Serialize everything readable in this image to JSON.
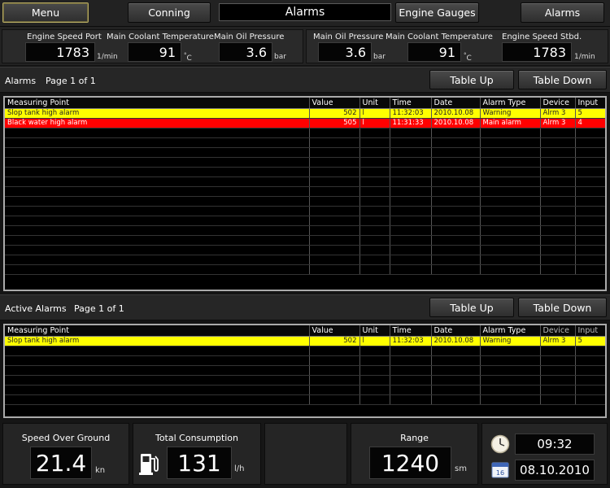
{
  "nav": {
    "menu": "Menu",
    "conning": "Conning",
    "title": "Alarms",
    "engine_gauges": "Engine Gauges",
    "alarms": "Alarms"
  },
  "gauges": {
    "port": [
      {
        "label": "Engine Speed Port",
        "value": "1783",
        "unit": "1/min"
      },
      {
        "label": "Main Coolant Temperature",
        "value": "91",
        "unit_prefix": "°",
        "unit": "C"
      },
      {
        "label": "Main Oil Pressure",
        "value": "3.6",
        "unit": "bar"
      }
    ],
    "stbd": [
      {
        "label": "Main Oil Pressure",
        "value": "3.6",
        "unit": "bar"
      },
      {
        "label": "Main Coolant Temperature",
        "value": "91",
        "unit_prefix": "°",
        "unit": "C"
      },
      {
        "label": "Engine Speed Stbd.",
        "value": "1783",
        "unit": "1/min"
      }
    ]
  },
  "alarms_section": {
    "title": "Alarms",
    "page": "Page 1 of 1",
    "table_up": "Table Up",
    "table_down": "Table Down"
  },
  "active_section": {
    "title": "Active Alarms",
    "page": "Page 1 of 1",
    "table_up": "Table Up",
    "table_down": "Table Down"
  },
  "columns": [
    "Measuring Point",
    "Value",
    "Unit",
    "Time",
    "Date",
    "Alarm Type",
    "Device",
    "Input"
  ],
  "alarm_rows": [
    {
      "point": "Slop tank high alarm",
      "value": "502",
      "unit": "l",
      "time": "11:32:03",
      "date": "2010.10.08",
      "type": "Warning",
      "device": "Alrm 3",
      "input": "5",
      "level": "warn"
    },
    {
      "point": "Black water high alarm",
      "value": "505",
      "unit": "l",
      "time": "11:31:33",
      "date": "2010.10.08",
      "type": "Main alarm",
      "device": "Alrm 3",
      "input": "4",
      "level": "alarm"
    }
  ],
  "active_rows": [
    {
      "point": "Slop tank high alarm",
      "value": "502",
      "unit": "l",
      "time": "11:32:03",
      "date": "2010.10.08",
      "type": "Warning",
      "device": "Alrm 3",
      "input": "5",
      "level": "warn"
    }
  ],
  "bottom": {
    "sog": {
      "label": "Speed Over Ground",
      "value": "21.4",
      "unit": "kn"
    },
    "consumption": {
      "label": "Total Consumption",
      "value": "131",
      "unit": "l/h",
      "icon": "fuel-pump-icon"
    },
    "range": {
      "label": "Range",
      "value": "1240",
      "unit": "sm"
    },
    "clock": {
      "time": "09:32",
      "date": "08.10.2010",
      "calendar_day": "16"
    }
  },
  "colors": {
    "warning": "#ffff00",
    "alarm": "#ff0000",
    "menu_border": "#b4a862"
  }
}
